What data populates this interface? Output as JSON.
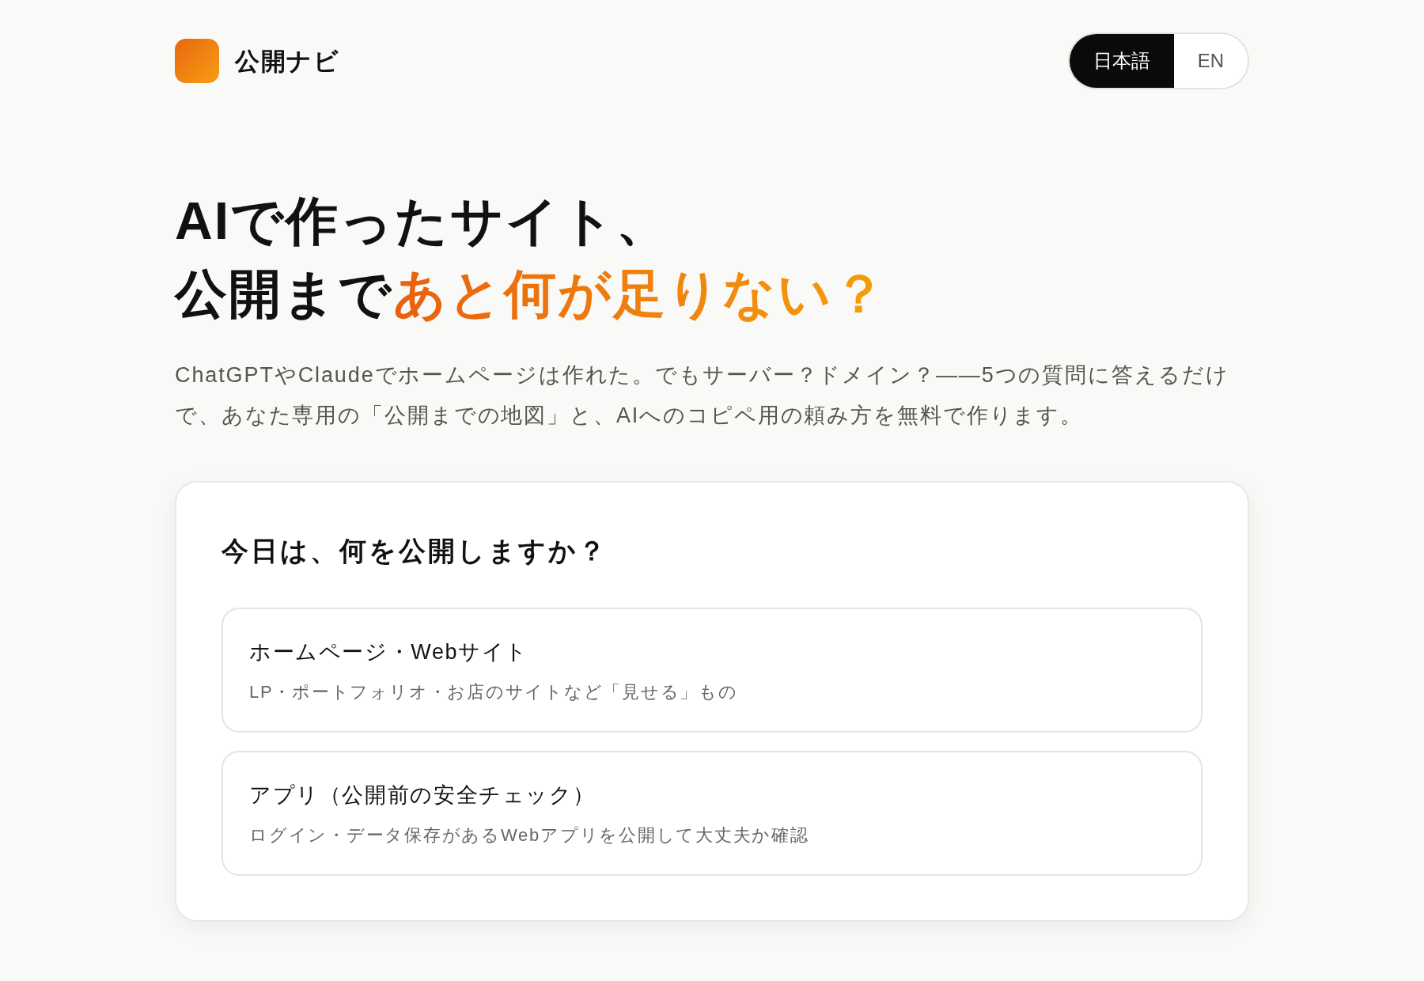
{
  "header": {
    "brand": "公開ナビ",
    "languages": [
      {
        "label": "日本語",
        "selected": true
      },
      {
        "label": "EN",
        "selected": false
      }
    ]
  },
  "hero": {
    "heading_line_1": "AIで作ったサイト、",
    "heading_line_2": "公開まで",
    "heading_highlight": "あと何が足りない？",
    "lead": "ChatGPTやClaudeでホームページは作れた。でもサーバー？ドメイン？——5つの質問に答えるだけで、あなた専用の「公開までの地図」と、AIへのコピペ用の頼み方を無料で作ります。"
  },
  "picker": {
    "title": "今日は、何を公開しますか？",
    "options": [
      {
        "title": "ホームページ・Webサイト",
        "description": "LP・ポートフォリオ・お店のサイトなど「見せる」もの"
      },
      {
        "title": "アプリ（公開前の安全チェック）",
        "description": "ログイン・データ保存があるWebアプリを公開して大丈夫か確認"
      }
    ]
  }
}
